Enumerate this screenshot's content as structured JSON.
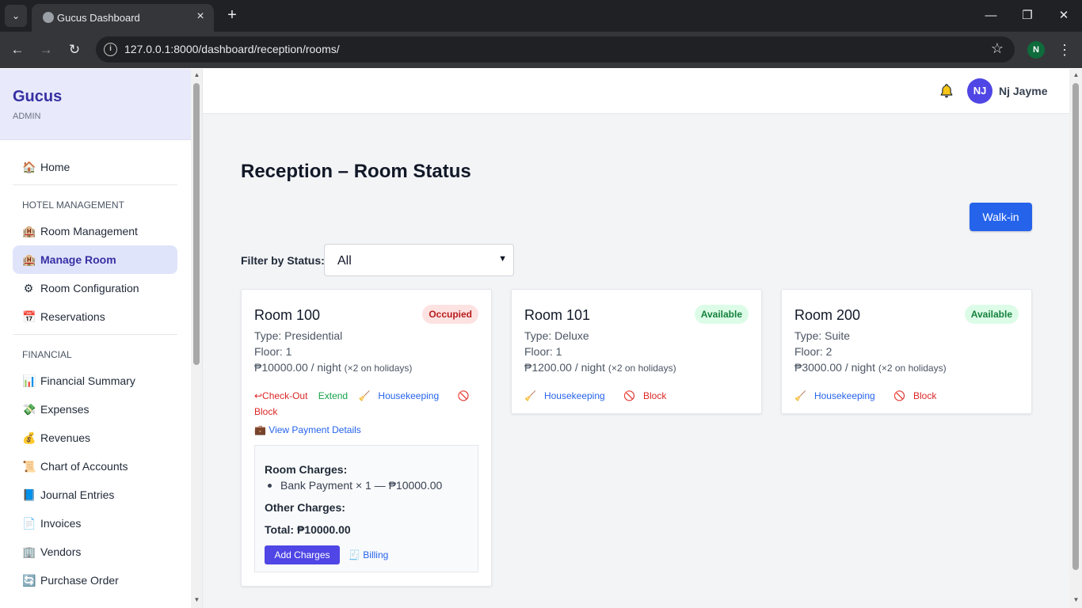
{
  "browser": {
    "tab_title": "Gucus Dashboard",
    "url": "127.0.0.1:8000/dashboard/reception/rooms/",
    "profile_initial": "N"
  },
  "sidebar": {
    "brand": "Gucus",
    "role": "ADMIN",
    "home": {
      "label": "Home",
      "icon": "🏠"
    },
    "section_hotel": "HOTEL MANAGEMENT",
    "hotel_items": [
      {
        "label": "Room Management",
        "icon": "🏨"
      },
      {
        "label": "Manage Room",
        "icon": "🏨"
      },
      {
        "label": "Room Configuration",
        "icon": "⚙"
      },
      {
        "label": "Reservations",
        "icon": "📅"
      }
    ],
    "section_financial": "FINANCIAL",
    "financial_items": [
      {
        "label": "Financial Summary",
        "icon": "📊"
      },
      {
        "label": "Expenses",
        "icon": "💸"
      },
      {
        "label": "Revenues",
        "icon": "💰"
      },
      {
        "label": "Chart of Accounts",
        "icon": "📜"
      },
      {
        "label": "Journal Entries",
        "icon": "📘"
      },
      {
        "label": "Invoices",
        "icon": "📄"
      },
      {
        "label": "Vendors",
        "icon": "🏢"
      },
      {
        "label": "Purchase Order",
        "icon": "🔄"
      }
    ]
  },
  "header": {
    "avatar_initials": "NJ",
    "user_name": "Nj Jayme"
  },
  "page": {
    "title": "Reception – Room Status",
    "walkin_label": "Walk-in",
    "filter_label": "Filter by Status:",
    "filter_value": "All"
  },
  "rooms": [
    {
      "name": "Room 100",
      "status": "Occupied",
      "type": "Type: Presidential",
      "floor": "Floor: 1",
      "rate": "₱10000.00 / night",
      "holiday": "(×2 on holidays)",
      "actions": {
        "checkout": "↩Check-Out",
        "extend": "Extend",
        "housekeeping": "Housekeeping",
        "block": "Block"
      },
      "payment_link": "View Payment Details",
      "charges": {
        "room_heading": "Room Charges:",
        "item": "Bank Payment × 1 — ₱10000.00",
        "other_heading": "Other Charges:",
        "total": "Total: ₱10000.00",
        "add_label": "Add Charges",
        "billing_label": "Billing"
      }
    },
    {
      "name": "Room 101",
      "status": "Available",
      "type": "Type: Deluxe",
      "floor": "Floor: 1",
      "rate": "₱1200.00 / night",
      "holiday": "(×2 on holidays)",
      "actions": {
        "housekeeping": "Housekeeping",
        "block": "Block"
      }
    },
    {
      "name": "Room 200",
      "status": "Available",
      "type": "Type: Suite",
      "floor": "Floor: 2",
      "rate": "₱3000.00 / night",
      "holiday": "(×2 on holidays)",
      "actions": {
        "housekeeping": "Housekeeping",
        "block": "Block"
      }
    }
  ],
  "colors": {
    "accent": "#4f46e5",
    "primary_button": "#2563eb",
    "occupied": "#b91c1c",
    "available": "#15803d"
  }
}
